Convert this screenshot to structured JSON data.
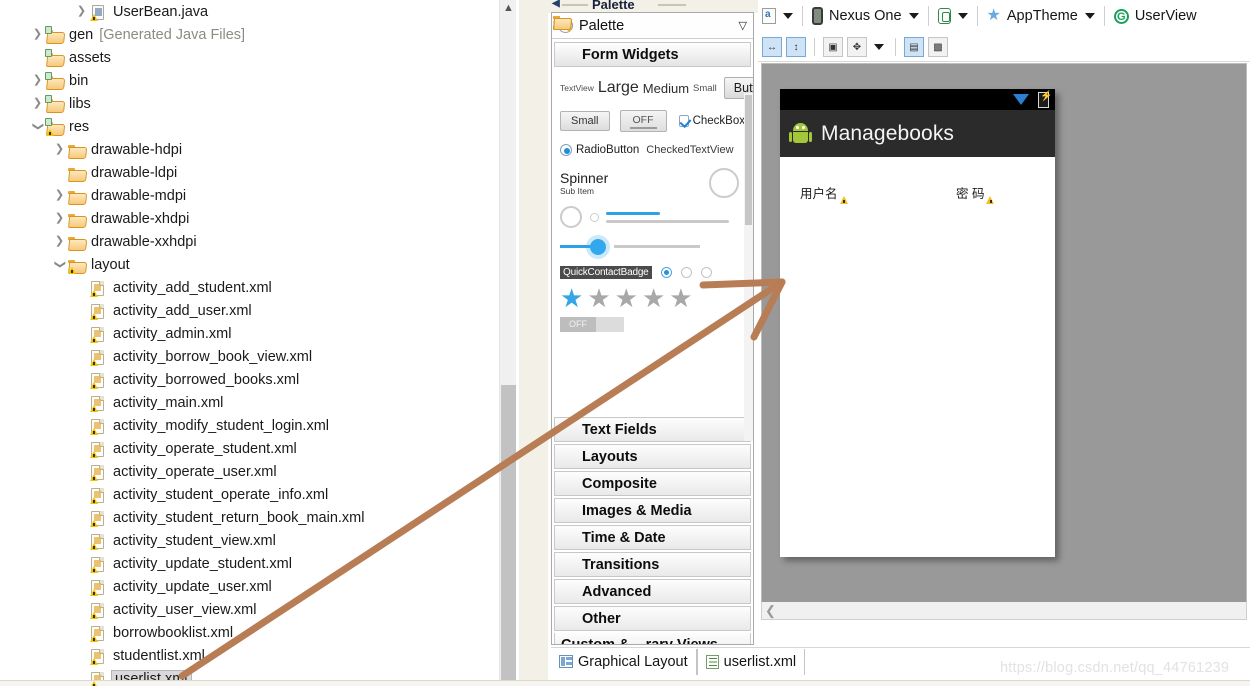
{
  "explorer": {
    "name": "package-explorer",
    "rows": [
      {
        "label": "UserBean.java",
        "indent": 3,
        "twisty": "collapsed",
        "icon": "java-file-icon",
        "selected": false,
        "suffix": ""
      },
      {
        "label": "gen",
        "indent": 1,
        "twisty": "collapsed",
        "icon": "source-folder-icon",
        "selected": false,
        "suffix": "[Generated Java Files]"
      },
      {
        "label": "assets",
        "indent": 1,
        "twisty": "none",
        "icon": "source-folder-icon",
        "selected": false,
        "suffix": ""
      },
      {
        "label": "bin",
        "indent": 1,
        "twisty": "collapsed",
        "icon": "source-folder-icon",
        "selected": false,
        "suffix": ""
      },
      {
        "label": "libs",
        "indent": 1,
        "twisty": "collapsed",
        "icon": "source-folder-icon",
        "selected": false,
        "suffix": ""
      },
      {
        "label": "res",
        "indent": 1,
        "twisty": "expanded",
        "icon": "source-folder-warn-icon",
        "selected": false,
        "suffix": ""
      },
      {
        "label": "drawable-hdpi",
        "indent": 2,
        "twisty": "collapsed",
        "icon": "folder-icon",
        "selected": false,
        "suffix": ""
      },
      {
        "label": "drawable-ldpi",
        "indent": 2,
        "twisty": "none",
        "icon": "folder-icon",
        "selected": false,
        "suffix": ""
      },
      {
        "label": "drawable-mdpi",
        "indent": 2,
        "twisty": "collapsed",
        "icon": "folder-icon",
        "selected": false,
        "suffix": ""
      },
      {
        "label": "drawable-xhdpi",
        "indent": 2,
        "twisty": "collapsed",
        "icon": "folder-icon",
        "selected": false,
        "suffix": ""
      },
      {
        "label": "drawable-xxhdpi",
        "indent": 2,
        "twisty": "collapsed",
        "icon": "folder-icon",
        "selected": false,
        "suffix": ""
      },
      {
        "label": "layout",
        "indent": 2,
        "twisty": "expanded",
        "icon": "folder-warn-icon",
        "selected": false,
        "suffix": ""
      },
      {
        "label": "activity_add_student.xml",
        "indent": 3,
        "twisty": "none",
        "icon": "xml-layout-file-icon",
        "selected": false,
        "suffix": ""
      },
      {
        "label": "activity_add_user.xml",
        "indent": 3,
        "twisty": "none",
        "icon": "xml-layout-file-icon",
        "selected": false,
        "suffix": ""
      },
      {
        "label": "activity_admin.xml",
        "indent": 3,
        "twisty": "none",
        "icon": "xml-layout-file-icon",
        "selected": false,
        "suffix": ""
      },
      {
        "label": "activity_borrow_book_view.xml",
        "indent": 3,
        "twisty": "none",
        "icon": "xml-layout-file-icon",
        "selected": false,
        "suffix": ""
      },
      {
        "label": "activity_borrowed_books.xml",
        "indent": 3,
        "twisty": "none",
        "icon": "xml-layout-file-icon",
        "selected": false,
        "suffix": ""
      },
      {
        "label": "activity_main.xml",
        "indent": 3,
        "twisty": "none",
        "icon": "xml-layout-file-icon",
        "selected": false,
        "suffix": ""
      },
      {
        "label": "activity_modify_student_login.xml",
        "indent": 3,
        "twisty": "none",
        "icon": "xml-layout-file-icon",
        "selected": false,
        "suffix": ""
      },
      {
        "label": "activity_operate_student.xml",
        "indent": 3,
        "twisty": "none",
        "icon": "xml-layout-file-icon",
        "selected": false,
        "suffix": ""
      },
      {
        "label": "activity_operate_user.xml",
        "indent": 3,
        "twisty": "none",
        "icon": "xml-layout-file-icon",
        "selected": false,
        "suffix": ""
      },
      {
        "label": "activity_student_operate_info.xml",
        "indent": 3,
        "twisty": "none",
        "icon": "xml-layout-file-icon",
        "selected": false,
        "suffix": ""
      },
      {
        "label": "activity_student_return_book_main.xml",
        "indent": 3,
        "twisty": "none",
        "icon": "xml-layout-file-icon",
        "selected": false,
        "suffix": ""
      },
      {
        "label": "activity_student_view.xml",
        "indent": 3,
        "twisty": "none",
        "icon": "xml-layout-file-icon",
        "selected": false,
        "suffix": ""
      },
      {
        "label": "activity_update_student.xml",
        "indent": 3,
        "twisty": "none",
        "icon": "xml-layout-file-icon",
        "selected": false,
        "suffix": ""
      },
      {
        "label": "activity_update_user.xml",
        "indent": 3,
        "twisty": "none",
        "icon": "xml-layout-file-icon",
        "selected": false,
        "suffix": ""
      },
      {
        "label": "activity_user_view.xml",
        "indent": 3,
        "twisty": "none",
        "icon": "xml-layout-file-icon",
        "selected": false,
        "suffix": ""
      },
      {
        "label": "borrowbooklist.xml",
        "indent": 3,
        "twisty": "none",
        "icon": "xml-layout-file-icon",
        "selected": false,
        "suffix": ""
      },
      {
        "label": "studentlist.xml",
        "indent": 3,
        "twisty": "none",
        "icon": "xml-layout-file-icon",
        "selected": false,
        "suffix": ""
      },
      {
        "label": "userlist.xml",
        "indent": 3,
        "twisty": "none",
        "icon": "xml-layout-file-icon",
        "selected": true,
        "suffix": ""
      }
    ]
  },
  "palette": {
    "tab_label": "Palette",
    "header_title": "Palette",
    "open_category": "Form Widgets",
    "widgets": {
      "textview": "TextView",
      "large": "Large",
      "medium": "Medium",
      "small": "Small",
      "button": "Button",
      "small_button": "Small",
      "off_button": "OFF",
      "checkbox": "CheckBox",
      "radiobutton": "RadioButton",
      "checkedtextview": "CheckedTextView",
      "spinner": "Spinner",
      "spinner_sub": "Sub Item",
      "quickcontactbadge": "QuickContactBadge",
      "toggle_off": "OFF",
      "rating_filled": 1,
      "rating_total": 5
    },
    "categories": [
      {
        "label": "Text Fields"
      },
      {
        "label": "Layouts"
      },
      {
        "label": "Composite"
      },
      {
        "label": "Images & Media"
      },
      {
        "label": "Time & Date"
      },
      {
        "label": "Transitions"
      },
      {
        "label": "Advanced"
      },
      {
        "label": "Other"
      }
    ],
    "custom_views": "Custom & ...rary Views"
  },
  "toolbar": {
    "config_label": "",
    "device": "Nexus One",
    "orientation_label": "",
    "theme": "AppTheme",
    "activity": "UserView",
    "row2": {
      "fit_width_title": "Fit width",
      "fit_height_title": "Fit height",
      "select_title": "Select",
      "distribute_title": "Distribute",
      "outline_title": "Show outline",
      "include_title": "Include in"
    }
  },
  "device_preview": {
    "app_title": "Managebooks",
    "username_label": "用户名",
    "password_label": "密 码",
    "status_icons": [
      "wifi-icon",
      "battery-icon"
    ]
  },
  "editor_tabs": [
    {
      "label": "Graphical Layout",
      "icon": "graphical-layout-icon",
      "active": false
    },
    {
      "label": "userlist.xml",
      "icon": "xml-source-icon",
      "active": true
    }
  ],
  "watermark": "https://blog.csdn.net/qq_44761239",
  "colors": {
    "canvas_bg": "#999999",
    "action_bar": "#2b2b2b",
    "status_bar": "#000000",
    "accent_blue": "#2aa2e8",
    "android_green": "#a4c639",
    "annotation_arrow": "#b87d55",
    "selection_grey": "#d9d9d9"
  }
}
